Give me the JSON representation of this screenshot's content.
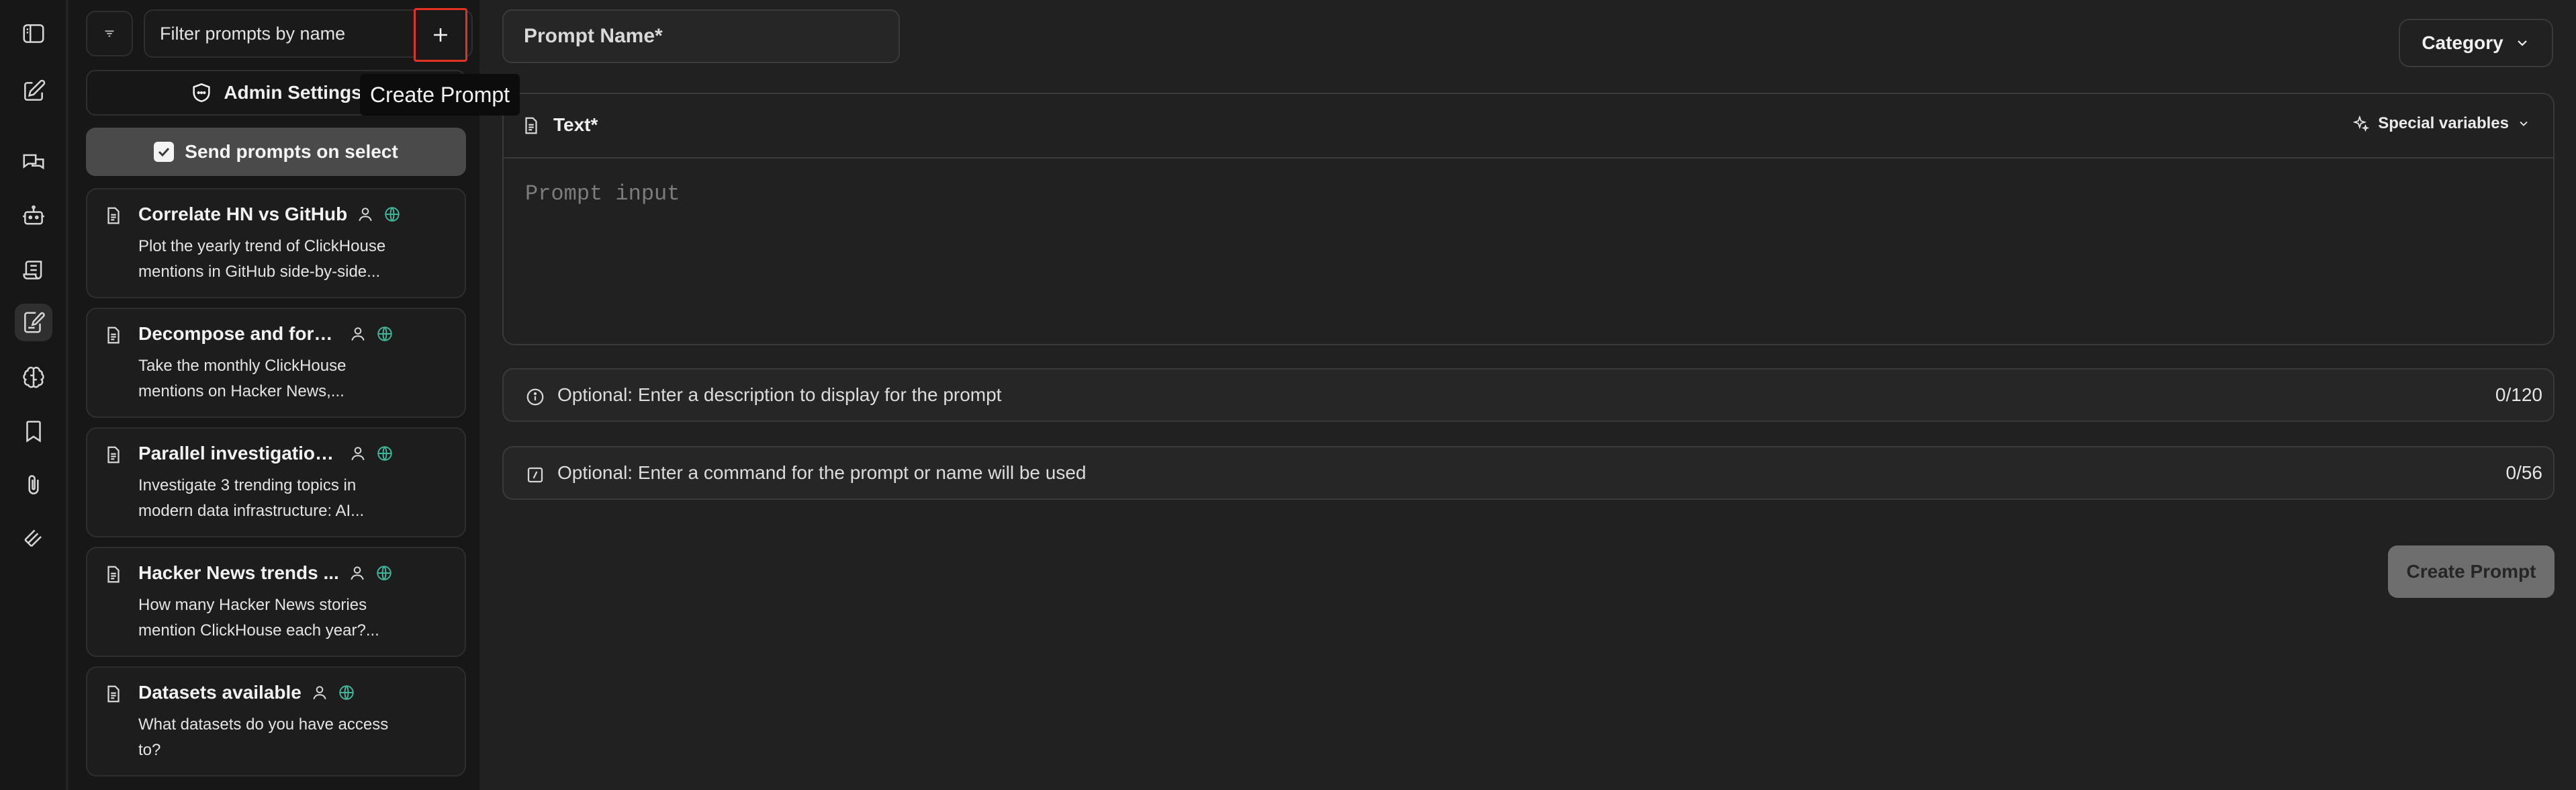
{
  "sidebar_rail": {
    "icons": [
      "sidebar-toggle-icon",
      "new-chat-icon",
      "chats-icon",
      "bot-icon",
      "scroll-icon",
      "prompts-icon",
      "brain-icon",
      "bookmark-icon",
      "paperclip-icon",
      "integrations-icon"
    ],
    "active": "prompts-icon"
  },
  "prompt_list": {
    "filter_placeholder": "Filter prompts by name",
    "add_tooltip": "Create Prompt",
    "admin_settings_label": "Admin Settings",
    "send_on_select_label": "Send prompts on select",
    "send_on_select_checked": true,
    "items": [
      {
        "title": "Correlate HN vs GitHub",
        "desc_line1": "Plot the yearly trend of ClickHouse",
        "desc_line2": "mentions in GitHub side-by-side..."
      },
      {
        "title": "Decompose and fore...",
        "desc_line1": "Take the monthly ClickHouse",
        "desc_line2": "mentions on Hacker News,..."
      },
      {
        "title": "Parallel investigation ...",
        "desc_line1": "Investigate 3 trending topics in",
        "desc_line2": "modern data infrastructure: AI..."
      },
      {
        "title": "Hacker News trends ...",
        "desc_line1": "How many Hacker News stories",
        "desc_line2": "mention ClickHouse each year?..."
      },
      {
        "title": "Datasets available",
        "desc_line1": "What datasets do you have access",
        "desc_line2": "to?"
      }
    ]
  },
  "editor": {
    "name_placeholder": "Prompt Name*",
    "category_label": "Category",
    "text_label": "Text*",
    "special_variables_label": "Special variables",
    "prompt_placeholder": "Prompt input",
    "description_placeholder": "Optional: Enter a description to display for the prompt",
    "description_count": "0/120",
    "command_placeholder": "Optional: Enter a command for the prompt or name will be used",
    "command_count": "0/56",
    "create_button_label": "Create Prompt"
  },
  "colors": {
    "background": "#212121",
    "sidebar": "#171717",
    "highlight_border": "#e53223",
    "globe_accent": "#3fb59a"
  }
}
